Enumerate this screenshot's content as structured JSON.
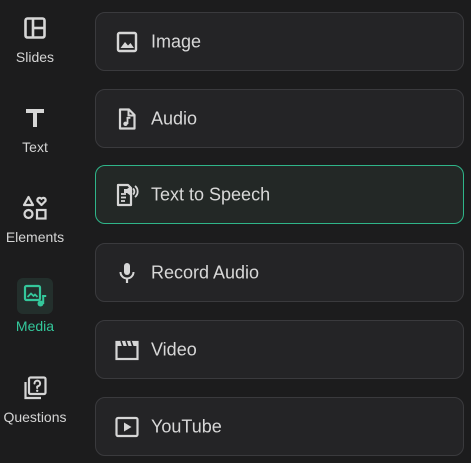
{
  "sidebar": {
    "items": [
      {
        "label": "Slides",
        "icon": "layout-icon"
      },
      {
        "label": "Text",
        "icon": "text-icon"
      },
      {
        "label": "Elements",
        "icon": "shapes-icon"
      },
      {
        "label": "Media",
        "icon": "media-icon",
        "active": true
      },
      {
        "label": "Questions",
        "icon": "question-icon"
      }
    ]
  },
  "media": {
    "options": [
      {
        "label": "Image",
        "icon": "image-icon"
      },
      {
        "label": "Audio",
        "icon": "audio-file-icon"
      },
      {
        "label": "Text to Speech",
        "icon": "text-to-speech-icon",
        "selected": true
      },
      {
        "label": "Record Audio",
        "icon": "microphone-icon"
      },
      {
        "label": "Video",
        "icon": "clapperboard-icon"
      },
      {
        "label": "YouTube",
        "icon": "play-icon"
      }
    ]
  },
  "colors": {
    "accent": "#34c79b",
    "background": "#1c1c1d",
    "card": "#242426",
    "card_border": "#3a3a3d"
  }
}
